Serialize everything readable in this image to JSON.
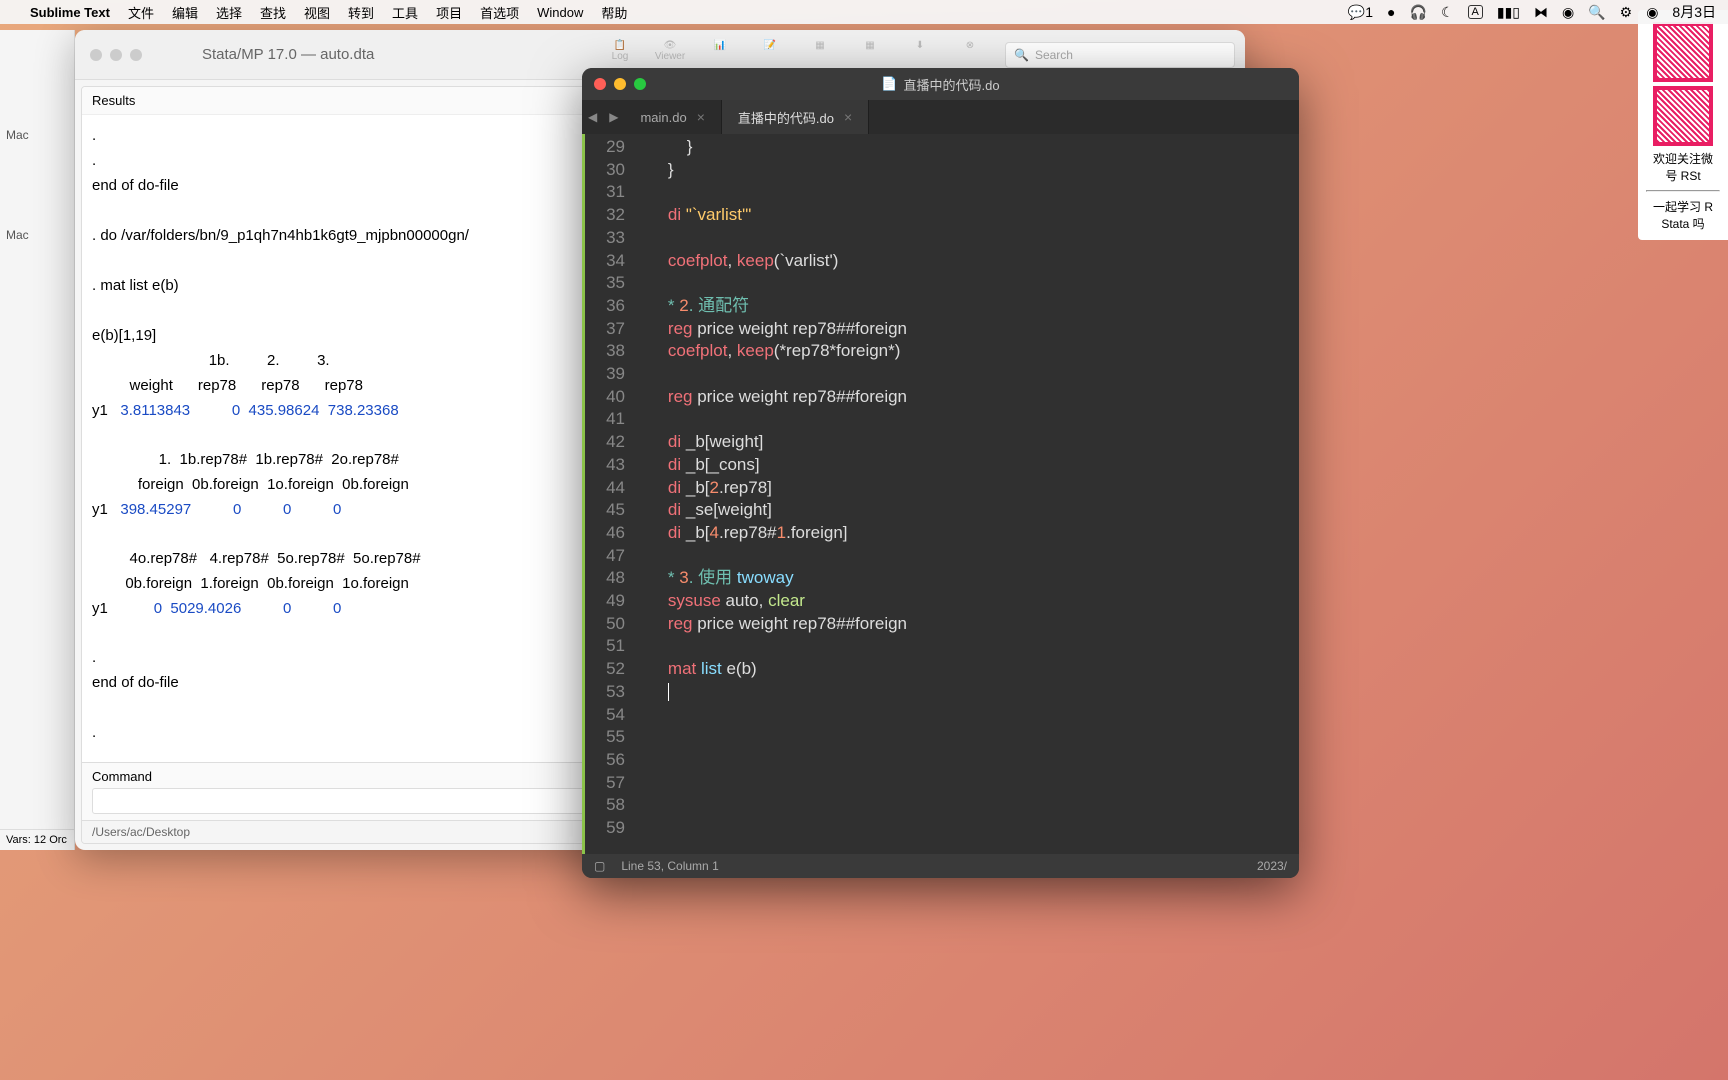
{
  "menubar": {
    "app": "Sublime Text",
    "items": [
      "文件",
      "编辑",
      "选择",
      "查找",
      "视图",
      "转到",
      "工具",
      "项目",
      "首选项",
      "Window",
      "帮助"
    ],
    "wechat_count": "1",
    "date": "8月3日"
  },
  "stata": {
    "title": "Stata/MP 17.0 — auto.dta",
    "toolbar_log": "Log",
    "toolbar_viewer": "Viewer",
    "search_placeholder": "Search",
    "results_label": "Results",
    "sidebar_mac1": "Mac",
    "sidebar_mac2": "Mac",
    "vars_label": "Vars: 12  Orc",
    "output_l1": ".",
    "output_l2": ".",
    "output_l3": "end of do-file",
    "output_l4": "",
    "output_l5": ". do /var/folders/bn/9_p1qh7n4hb1k6gt9_mjpbn00000gn/",
    "output_l6": "",
    "output_l7": ". mat list e(b)",
    "output_l8": "",
    "output_l9": "e(b)[1,19]",
    "hdr1": "                            1b.         2.         3.",
    "hdr2": "         weight      rep78      rep78      rep78",
    "row1_label": "y1   ",
    "row1_v1": "3.8113843",
    "row1_v2": "          0",
    "row1_v3": "  435.98624",
    "row1_v4": "  738.23368",
    "hdr3": "                1.  1b.rep78#  1b.rep78#  2o.rep78#",
    "hdr4": "           foreign  0b.foreign  1o.foreign  0b.foreign",
    "row2_label": "y1   ",
    "row2_v1": "398.45297",
    "row2_v2": "          0",
    "row2_v3": "          0",
    "row2_v4": "          0",
    "hdr5": "         4o.rep78#   4.rep78#  5o.rep78#  5o.rep78#",
    "hdr6": "        0b.foreign  1.foreign  0b.foreign  1o.foreign",
    "row3_label": "y1   ",
    "row3_v1": "        0",
    "row3_v2": "  5029.4026",
    "row3_v3": "          0",
    "row3_v4": "          0",
    "output_end1": ".",
    "output_end2": "end of do-file",
    "output_end3": "",
    "output_end4": ".",
    "command_label": "Command",
    "footer_path": "/Users/ac/Desktop"
  },
  "sublime": {
    "title": "直播中的代码.do",
    "tab1": "main.do",
    "tab2": "直播中的代码.do",
    "status_line": "Line 53, Column 1",
    "status_year": "2023/",
    "lines": {
      "29": {
        "indent": "        ",
        "t1": "}"
      },
      "30": {
        "indent": "    ",
        "t1": "}"
      },
      "31": {
        "indent": "",
        "t1": ""
      },
      "32": {
        "indent": "    ",
        "di": "di",
        "str": " \"`varlist'\""
      },
      "33": {
        "indent": "",
        "t1": ""
      },
      "34": {
        "indent": "    ",
        "cmd": "coefplot",
        "comma": ", ",
        "opt": "keep",
        "paren": "(`varlist')"
      },
      "35": {
        "indent": "",
        "t1": ""
      },
      "36": {
        "indent": "    ",
        "star": "* ",
        "num": "2",
        "dot": ". ",
        "zh": "通配符"
      },
      "37": {
        "indent": "    ",
        "cmd": "reg",
        "rest": " price weight rep78##foreign"
      },
      "38": {
        "indent": "    ",
        "cmd": "coefplot",
        "comma": ", ",
        "opt": "keep",
        "paren": "(*rep78*foreign*)"
      },
      "39": {
        "indent": "",
        "t1": ""
      },
      "40": {
        "indent": "    ",
        "cmd": "reg",
        "rest": " price weight rep78##foreign"
      },
      "41": {
        "indent": "",
        "t1": ""
      },
      "42": {
        "indent": "    ",
        "di": "di",
        "rest": " _b[weight]"
      },
      "43": {
        "indent": "    ",
        "di": "di",
        "rest": " _b[_cons]"
      },
      "44": {
        "indent": "    ",
        "di": "di",
        "pre": " _b[",
        "n": "2",
        "post": ".rep78]"
      },
      "45": {
        "indent": "    ",
        "di": "di",
        "rest": " _se[weight]"
      },
      "46": {
        "indent": "    ",
        "di": "di",
        "pre": " _b[",
        "n": "4",
        "mid": ".rep78#",
        "n2": "1",
        "post": ".foreign]"
      },
      "47": {
        "indent": "",
        "t1": ""
      },
      "48": {
        "indent": "    ",
        "star": "* ",
        "num": "3",
        "dot": ". ",
        "zh": "使用 ",
        "tw": "twoway"
      },
      "49": {
        "indent": "    ",
        "cmd": "sysuse",
        "arg": " auto",
        "comma": ", ",
        "opt": "clear"
      },
      "50": {
        "indent": "    ",
        "cmd": "reg",
        "rest": " price weight rep78##foreign"
      },
      "51": {
        "indent": "",
        "t1": ""
      },
      "52": {
        "indent": "    ",
        "cmd": "mat",
        "sub": " list",
        "rest": " e(b)"
      },
      "53": {
        "indent": "    ",
        "t1": ""
      },
      "54": {
        "indent": "",
        "t1": ""
      },
      "55": {
        "indent": "",
        "t1": ""
      },
      "56": {
        "indent": "",
        "t1": ""
      },
      "57": {
        "indent": "",
        "t1": ""
      },
      "58": {
        "indent": "",
        "t1": ""
      },
      "59": {
        "indent": "",
        "t1": ""
      }
    }
  },
  "qr": {
    "text1": "欢迎关注微",
    "text2": "号 RSt",
    "text3": "一起学习 R",
    "text4": "Stata 吗"
  }
}
